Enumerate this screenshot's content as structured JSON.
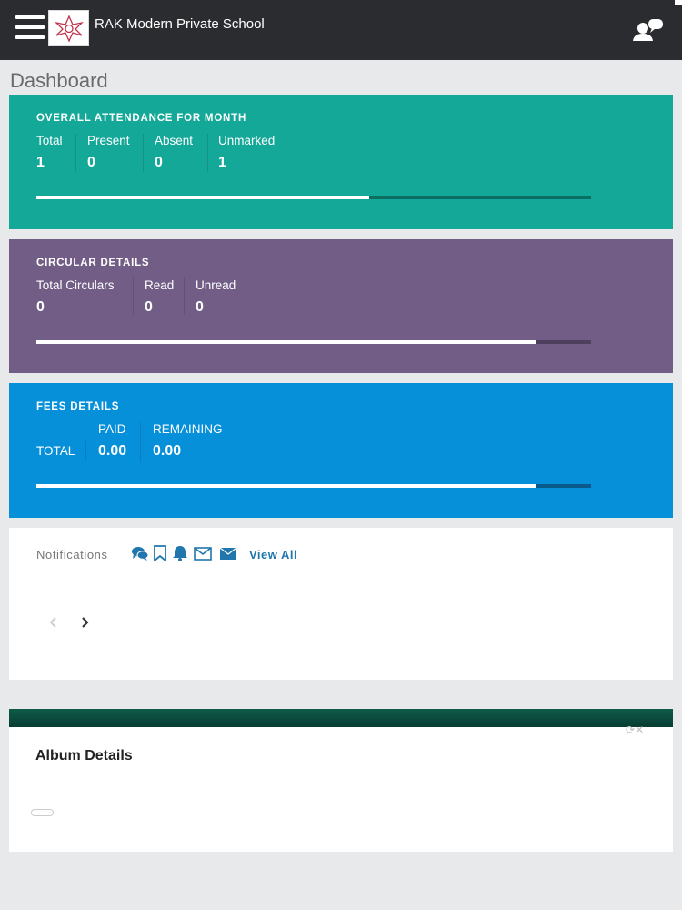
{
  "header": {
    "school_name": "RAK Modern Private School"
  },
  "page": {
    "title": "Dashboard"
  },
  "attendance": {
    "title": "OVERALL ATTENDANCE FOR  MONTH",
    "stats": [
      {
        "label": "Total",
        "value": "1"
      },
      {
        "label": "Present",
        "value": "0"
      },
      {
        "label": "Absent",
        "value": "0"
      },
      {
        "label": "Unmarked",
        "value": "1"
      }
    ],
    "progress_fraction": 0.6
  },
  "circular": {
    "title": "CIRCULAR DETAILS",
    "stats": [
      {
        "label": "Total Circulars",
        "value": "0"
      },
      {
        "label": "Read",
        "value": "0"
      },
      {
        "label": "Unread",
        "value": "0"
      }
    ],
    "progress_fraction": 0.9
  },
  "fees": {
    "title": "FEES  DETAILS",
    "total_label": "TOTAL",
    "paid_label": "PAID",
    "paid_value": "0.00",
    "remaining_label": "REMAINING",
    "remaining_value": "0.00",
    "progress_fraction": 0.9
  },
  "notifications": {
    "label": "Notifications",
    "icons": [
      "comments-icon",
      "bookmark-icon",
      "bell-icon",
      "envelope-outline-icon",
      "envelope-icon"
    ],
    "view_all": "View All"
  },
  "album": {
    "title": "Album Details"
  },
  "colors": {
    "topbar": "#2a2c2f",
    "attendance": "#13a898",
    "circular": "#715d86",
    "fees": "#0790da",
    "link": "#2176ae"
  }
}
